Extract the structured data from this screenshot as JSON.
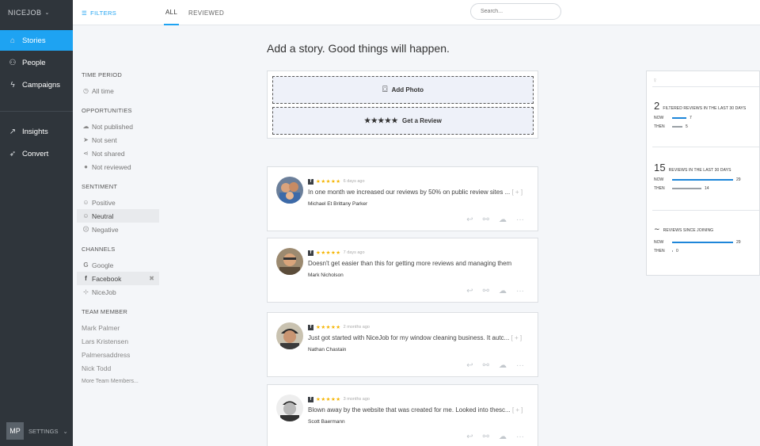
{
  "app": {
    "brand": "NICEJOB"
  },
  "sidebar": {
    "items": [
      {
        "label": "Stories",
        "icon": "home-icon"
      },
      {
        "label": "People",
        "icon": "person-icon"
      },
      {
        "label": "Campaigns",
        "icon": "bolt-icon"
      },
      {
        "label": "Insights",
        "icon": "trend-icon"
      },
      {
        "label": "Convert",
        "icon": "rocket-icon"
      }
    ],
    "user_initials": "MP",
    "settings_label": "SETTINGS"
  },
  "topbar": {
    "filters_label": "FILTERS",
    "tabs": [
      {
        "label": "ALL"
      },
      {
        "label": "REVIEWED"
      }
    ],
    "search_placeholder": "Search..."
  },
  "filters": {
    "time_period": {
      "title": "TIME PERIOD",
      "items": [
        "All time"
      ]
    },
    "opportunities": {
      "title": "OPPORTUNITIES",
      "items": [
        "Not published",
        "Not sent",
        "Not shared",
        "Not reviewed"
      ]
    },
    "sentiment": {
      "title": "SENTIMENT",
      "items": [
        "Positive",
        "Neutral",
        "Negative"
      ]
    },
    "channels": {
      "title": "CHANNELS",
      "items": [
        "Google",
        "Facebook",
        "NiceJob"
      ]
    },
    "team": {
      "title": "TEAM MEMBER",
      "items": [
        "Mark Palmer",
        "Lars Kristensen",
        "Palmersaddress",
        "Nick Todd"
      ],
      "more": "More Team Members..."
    }
  },
  "main": {
    "headline": "Add a story. Good things will happen.",
    "add_photo": "Add Photo",
    "get_review": "Get a Review",
    "stars": "★★★★★",
    "more_link": "[ + ]",
    "reviews": [
      {
        "time": "6 days ago",
        "text": "In one month we increased our reviews by 50% on public review sites ...",
        "name": "Michael Et Brittany Parker",
        "more": true
      },
      {
        "time": "7 days ago",
        "text": "Doesn't get easier than this for getting more reviews and managing them",
        "name": "Mark Nicholson",
        "more": false
      },
      {
        "time": "2 months ago",
        "text": "Just got started with NiceJob for my window cleaning business. It autc...",
        "name": "Nathan Chastain",
        "more": true
      },
      {
        "time": "3 months ago",
        "text": "Blown away by the website that was created for me. Looked into thesc...",
        "name": "Scott Baermann",
        "more": true
      }
    ]
  },
  "stats": {
    "blocks": [
      {
        "num": "2",
        "label": "FILTERED REVIEWS IN THE LAST 30 DAYS",
        "now": 7,
        "then": 5
      },
      {
        "num": "15",
        "label": "REVIEWS IN THE LAST 30 DAYS",
        "now": 29,
        "then": 14
      },
      {
        "num": "∼",
        "label": "REVIEWS SINCE JOINING",
        "now": 29,
        "then": 0
      }
    ],
    "now_label": "NOW",
    "then_label": "THEN"
  },
  "colors": {
    "accent": "#1ea3f2",
    "sidebar": "#2f353b",
    "star": "#f5b400"
  }
}
